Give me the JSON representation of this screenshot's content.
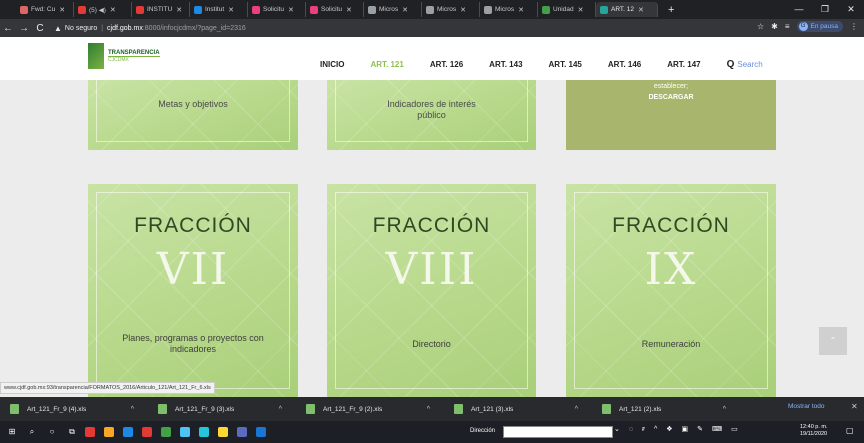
{
  "browser": {
    "tabs": [
      {
        "label": "Fwd: Cu",
        "color": "#e06666",
        "active": false
      },
      {
        "label": "(5) ◀)",
        "color": "#e53935",
        "active": false
      },
      {
        "label": "INSTITU",
        "color": "#e53935",
        "active": false
      },
      {
        "label": "Institut",
        "color": "#1e88e5",
        "active": false
      },
      {
        "label": "Solicitu",
        "color": "#ec407a",
        "active": false
      },
      {
        "label": "Solicitu",
        "color": "#ec407a",
        "active": false
      },
      {
        "label": "Micros",
        "color": "#9aa0a6",
        "active": false
      },
      {
        "label": "Micros",
        "color": "#9aa0a6",
        "active": false
      },
      {
        "label": "Micros",
        "color": "#9aa0a6",
        "active": false
      },
      {
        "label": "Unidad",
        "color": "#43a047",
        "active": false
      },
      {
        "label": "ART. 12",
        "color": "#26a69a",
        "active": true
      }
    ],
    "new_tab": "+",
    "security": "No seguro",
    "host": "cjdf.gob.mx",
    "path": ":8000/infocjcdmx/?page_id=2316",
    "profile_status": "En pausa",
    "profile_initial": "G"
  },
  "site": {
    "logo_title": "TRANSPARENCIA",
    "logo_sub": "CJCDMX",
    "menu": [
      {
        "label": "INICIO",
        "active": false
      },
      {
        "label": "ART. 121",
        "active": true
      },
      {
        "label": "ART. 126",
        "active": false
      },
      {
        "label": "ART. 143",
        "active": false
      },
      {
        "label": "ART. 145",
        "active": false
      },
      {
        "label": "ART. 146",
        "active": false
      },
      {
        "label": "ART. 147",
        "active": false
      }
    ],
    "search_label": "Search"
  },
  "top_cards": [
    {
      "label": "Metas y objetivos"
    },
    {
      "label": "Indicadores de interés público"
    },
    {
      "label": "establecer;",
      "link": "DESCARGAR"
    }
  ],
  "cards": [
    {
      "title": "FRACCIÓN",
      "numeral": "VII",
      "description": "Planes, programas o proyectos con indicadores"
    },
    {
      "title": "FRACCIÓN",
      "numeral": "VIII",
      "description": "Directorio"
    },
    {
      "title": "FRACCIÓN",
      "numeral": "IX",
      "description": "Remuneración"
    }
  ],
  "status_url": "www.cjdf.gob.mx:93/transparencia/FORMATOS_2016/Articulo_121/Art_121_Fr_6.xls",
  "downloads": [
    {
      "name": "Art_121_Fr_9 (4).xls"
    },
    {
      "name": "Art_121_Fr_9 (3).xls"
    },
    {
      "name": "Art_121_Fr_9 (2).xls"
    },
    {
      "name": "Art_121 (3).xls"
    },
    {
      "name": "Art_121 (2).xls"
    }
  ],
  "show_all": "Mostrar todo",
  "taskbar": {
    "address_label": "Dirección",
    "time": "12:40 p. m.",
    "date": "19/11/2020"
  }
}
